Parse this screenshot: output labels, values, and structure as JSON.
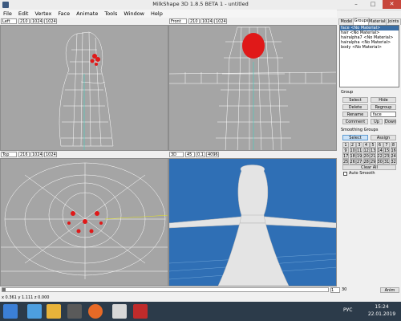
{
  "window": {
    "title": "MilkShape 3D 1.8.5 BETA 1 - untitled",
    "min": "–",
    "max": "□",
    "close": "✕"
  },
  "menu": [
    "File",
    "Edit",
    "Vertex",
    "Face",
    "Animate",
    "Tools",
    "Window",
    "Help"
  ],
  "viewports": {
    "left": {
      "view": "Left",
      "f1": "210",
      "f2": "1024",
      "f3": "1024"
    },
    "front": {
      "view": "Front",
      "f1": "210",
      "f2": "1024",
      "f3": "1024"
    },
    "top": {
      "view": "Top",
      "f1": "216",
      "f2": "1024",
      "f3": "1024"
    },
    "persp": {
      "view": "3D",
      "f1": "45",
      "f2": "0.1",
      "f3": "4096"
    }
  },
  "panel": {
    "tabs": [
      "Model",
      "Groups",
      "Materials",
      "Joints"
    ],
    "groups": [
      "face <No Material>",
      "hair <No Material>",
      "hairalpha7 <No Material>",
      "hairalpha <No Material>",
      "body <No Material>"
    ],
    "group_section": "Group",
    "buttons": {
      "select": "Select",
      "hide": "Hide",
      "delete": "Delete",
      "regroup": "Regroup",
      "rename": "Rename",
      "comment": "Comment",
      "up": "Up",
      "down": "Down"
    },
    "name_value": "face",
    "smoothing_title": "Smoothing Groups",
    "smoothing_select": "Select",
    "smoothing_assign": "Assign",
    "smoothing_numbers": [
      "1",
      "2",
      "3",
      "4",
      "5",
      "6",
      "7",
      "8",
      "9",
      "10",
      "11",
      "12",
      "13",
      "14",
      "15",
      "16",
      "17",
      "18",
      "19",
      "20",
      "21",
      "22",
      "23",
      "24",
      "25",
      "26",
      "27",
      "28",
      "29",
      "30",
      "31",
      "32"
    ],
    "clear_all": "Clear All",
    "auto_smooth": "Auto Smooth"
  },
  "timeline": {
    "frame": "1",
    "total": "30",
    "anim": "Anim"
  },
  "status": "x 0.361 y 1.111 z 0.000",
  "taskbar": {
    "lang": "РУС",
    "time": "15:24",
    "date": "22.01.2019"
  },
  "colors": {
    "viewport_bg": "#a5a5a5",
    "persp_bg": "#2f6fb5",
    "wire": "#ffffff",
    "selected": "#e01919",
    "taskbar": "#2c3b4a"
  }
}
